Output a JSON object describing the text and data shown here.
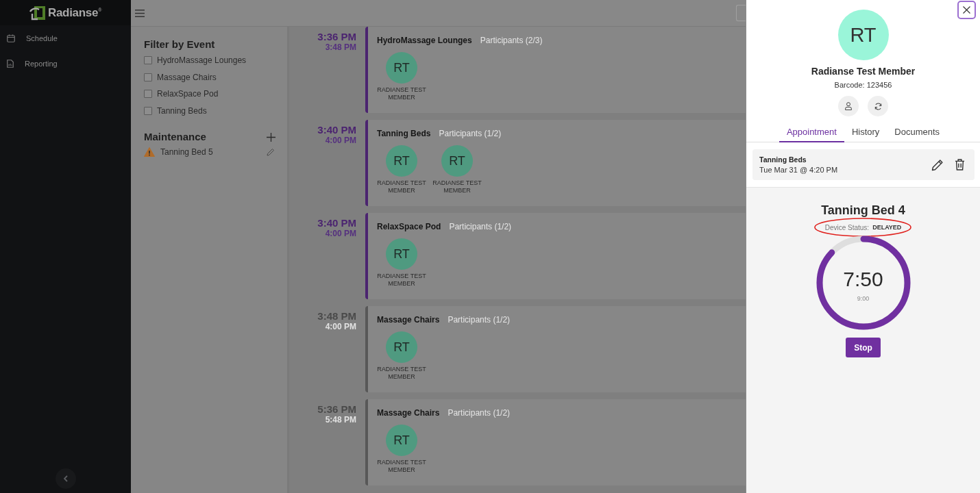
{
  "sidebar": {
    "logo": "Radianse$^{®}$",
    "items": [
      {
        "label": "Schedule"
      },
      {
        "label": "Reporting"
      }
    ]
  },
  "filter": {
    "title": "Filter by Event",
    "options": [
      {
        "label": "HydroMassage Lounges",
        "checked": false
      },
      {
        "label": "Massage Chairs",
        "checked": false
      },
      {
        "label": "RelaxSpace Pod",
        "checked": false
      },
      {
        "label": "Tanning Beds",
        "checked": false
      }
    ]
  },
  "maintenance": {
    "title": "Maintenance",
    "items": [
      {
        "label": "Tanning Bed 5",
        "warning": true
      }
    ]
  },
  "schedule": [
    {
      "start": "3:36 PM",
      "end": "3:48 PM",
      "active": true,
      "title": "HydroMassage Lounges",
      "participants_label": "Participants (2/3)",
      "participants": [
        {
          "initials": "RT",
          "name": "RADIANSE TEST MEMBER"
        }
      ]
    },
    {
      "start": "3:40 PM",
      "end": "4:00 PM",
      "active": true,
      "title": "Tanning Beds",
      "participants_label": "Participants (1/2)",
      "participants": [
        {
          "initials": "RT",
          "name": "RADIANSE TEST MEMBER"
        },
        {
          "initials": "RT",
          "name": "RADIANSE TEST MEMBER"
        }
      ]
    },
    {
      "start": "3:40 PM",
      "end": "4:00 PM",
      "active": true,
      "title": "RelaxSpace Pod",
      "participants_label": "Participants (1/2)",
      "participants": [
        {
          "initials": "RT",
          "name": "RADIANSE TEST MEMBER"
        }
      ]
    },
    {
      "start": "3:48 PM",
      "end": "4:00 PM",
      "active": false,
      "title": "Massage Chairs",
      "participants_label": "Participants (1/2)",
      "participants": [
        {
          "initials": "RT",
          "name": "RADIANSE TEST MEMBER"
        }
      ]
    },
    {
      "start": "5:36 PM",
      "end": "5:48 PM",
      "active": false,
      "title": "Massage Chairs",
      "participants_label": "Participants (1/2)",
      "participants": [
        {
          "initials": "RT",
          "name": "RADIANSE TEST MEMBER"
        }
      ]
    }
  ],
  "drawer": {
    "avatar": "RT",
    "name": "Radianse Test Member",
    "barcode": "Barcode: 123456",
    "tabs": [
      {
        "label": "Appointment",
        "selected": true
      },
      {
        "label": "History",
        "selected": false
      },
      {
        "label": "Documents",
        "selected": false
      }
    ],
    "appointment": {
      "title": "Tanning Beds",
      "when": "Tue Mar 31 @ 4:20 PM"
    },
    "device": {
      "name": "Tanning Bed 4",
      "status_label": "Device Status:",
      "status": "DELAYED",
      "circled": true,
      "level": 0.87,
      "remaining": "7:50",
      "total": "9:00"
    },
    "stop_button": "Stop"
  }
}
